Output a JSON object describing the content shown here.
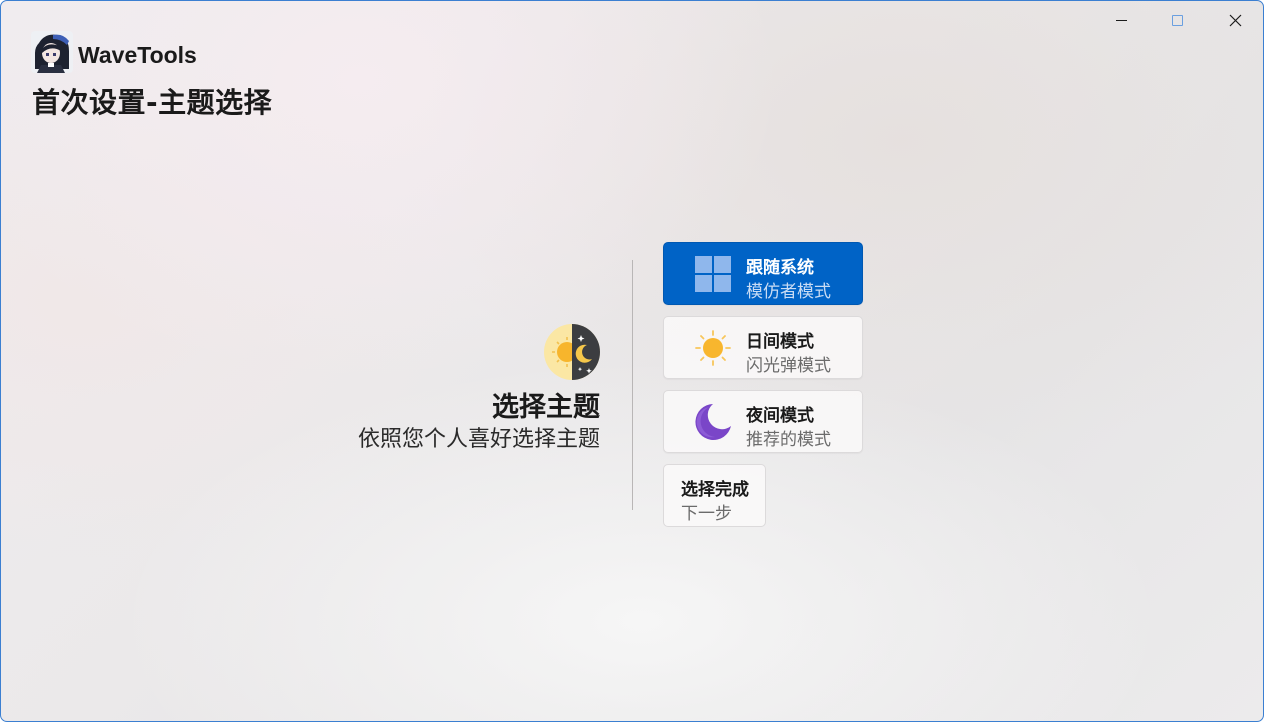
{
  "window": {
    "app_title": "WaveTools",
    "page_title": "首次设置-主题选择",
    "accent_color": "#0063c6"
  },
  "caption": {
    "minimize_icon": "minimize-icon",
    "maximize_icon": "maximize-icon",
    "close_icon": "close-icon",
    "close_glyph": "✕"
  },
  "intro": {
    "icon": "theme-sun-moon-icon",
    "heading": "选择主题",
    "subheading": "依照您个人喜好选择主题"
  },
  "options": [
    {
      "title": "跟随系统",
      "subtitle": "模仿者模式",
      "icon": "windows-logo-icon",
      "selected": true
    },
    {
      "title": "日间模式",
      "subtitle": "闪光弹模式",
      "icon": "sun-icon",
      "selected": false
    },
    {
      "title": "夜间模式",
      "subtitle": "推荐的模式",
      "icon": "moon-icon",
      "selected": false
    }
  ],
  "done": {
    "title": "选择完成",
    "subtitle": "下一步"
  }
}
